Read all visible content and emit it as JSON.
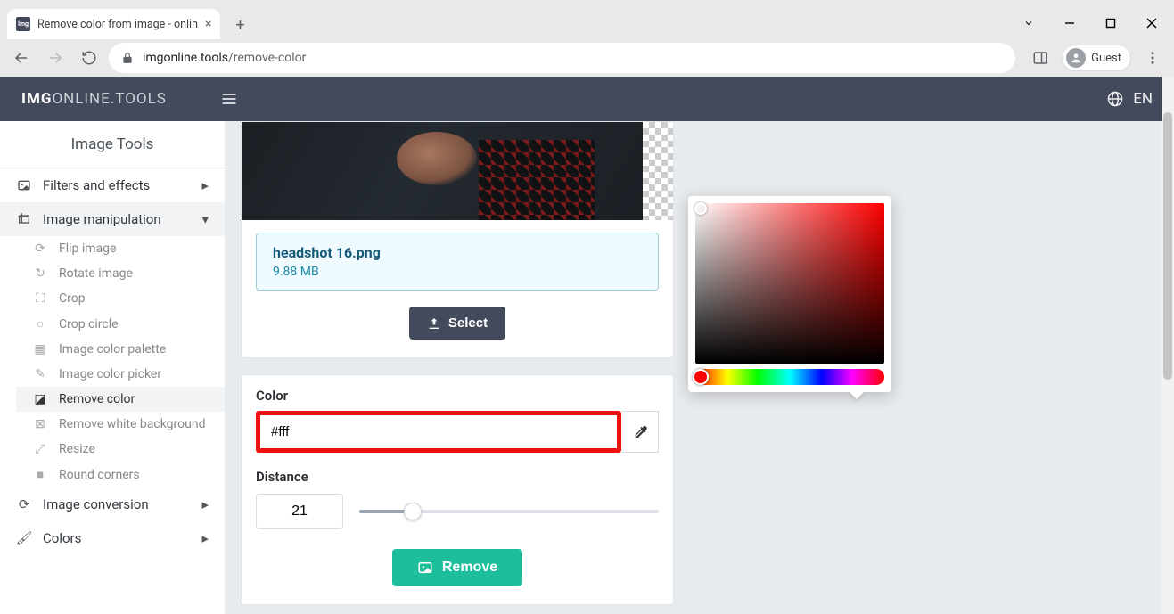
{
  "browser": {
    "tab_title": "Remove color from image - onlin",
    "url_host": "imgonline.tools",
    "url_path": "/remove-color",
    "guest_label": "Guest"
  },
  "header": {
    "logo_bold": "IMG",
    "logo_rest": "ONLINE.TOOLS",
    "lang": "EN"
  },
  "sidebar": {
    "title": "Image Tools",
    "groups": [
      {
        "id": "filters",
        "label": "Filters and effects"
      },
      {
        "id": "manip",
        "label": "Image manipulation"
      },
      {
        "id": "conv",
        "label": "Image conversion"
      },
      {
        "id": "colors",
        "label": "Colors"
      }
    ],
    "manip_items": [
      {
        "id": "flip",
        "label": "Flip image"
      },
      {
        "id": "rotate",
        "label": "Rotate image"
      },
      {
        "id": "crop",
        "label": "Crop"
      },
      {
        "id": "cropcircle",
        "label": "Crop circle"
      },
      {
        "id": "palette",
        "label": "Image color palette"
      },
      {
        "id": "picker",
        "label": "Image color picker"
      },
      {
        "id": "removecolor",
        "label": "Remove color"
      },
      {
        "id": "removewhite",
        "label": "Remove white background"
      },
      {
        "id": "resize",
        "label": "Resize"
      },
      {
        "id": "round",
        "label": "Round corners"
      }
    ]
  },
  "file": {
    "name": "headshot 16.png",
    "size": "9.88 MB",
    "select_label": "Select"
  },
  "form": {
    "color_label": "Color",
    "color_value": "#fff",
    "distance_label": "Distance",
    "distance_value": "21",
    "remove_label": "Remove"
  }
}
